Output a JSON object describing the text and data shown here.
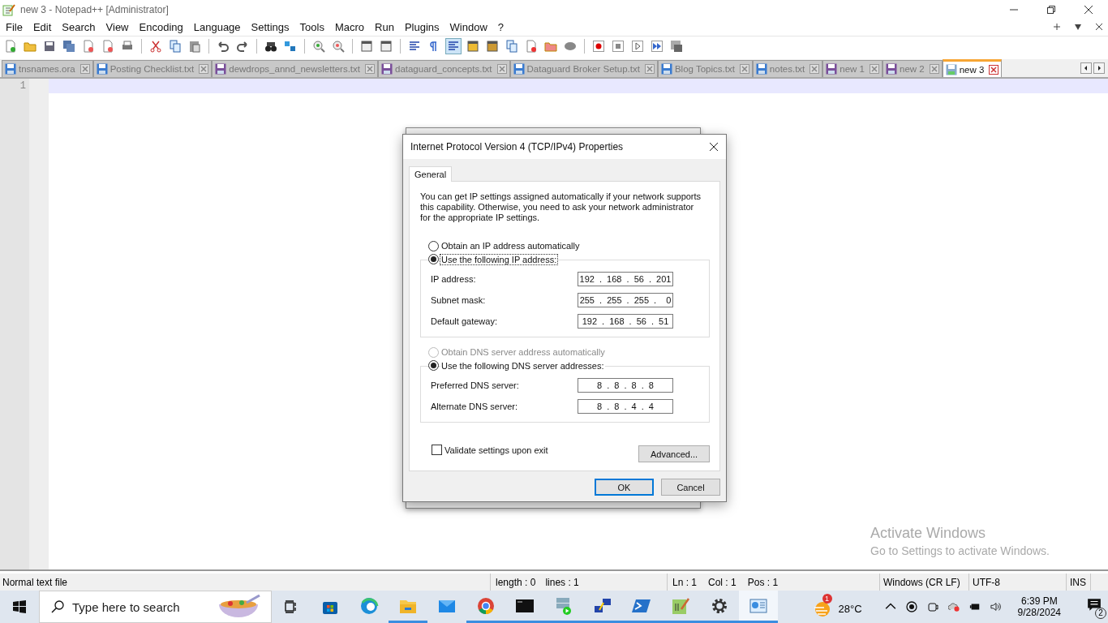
{
  "window": {
    "title": "new 3 - Notepad++ [Administrator]"
  },
  "menu": [
    "File",
    "Edit",
    "Search",
    "View",
    "Encoding",
    "Language",
    "Settings",
    "Tools",
    "Macro",
    "Run",
    "Plugins",
    "Window",
    "?"
  ],
  "tabs": [
    {
      "label": "tnsnames.ora",
      "selected": false,
      "unsaved": false
    },
    {
      "label": "Posting Checklist.txt",
      "selected": false,
      "unsaved": false
    },
    {
      "label": "dewdrops_annd_newsletters.txt",
      "selected": false,
      "unsaved": true
    },
    {
      "label": "dataguard_concepts.txt",
      "selected": false,
      "unsaved": true
    },
    {
      "label": "Dataguard Broker Setup.txt",
      "selected": false,
      "unsaved": false
    },
    {
      "label": "Blog Topics.txt",
      "selected": false,
      "unsaved": false
    },
    {
      "label": "notes.txt",
      "selected": false,
      "unsaved": false
    },
    {
      "label": "new 1",
      "selected": false,
      "unsaved": true
    },
    {
      "label": "new 2",
      "selected": false,
      "unsaved": true
    },
    {
      "label": "new 3",
      "selected": true,
      "unsaved": false
    }
  ],
  "editor": {
    "line_numbers": [
      "1"
    ]
  },
  "dialog": {
    "title": "Internet Protocol Version 4 (TCP/IPv4) Properties",
    "tabs": [
      {
        "label": "General",
        "selected": true
      }
    ],
    "description": "You can get IP settings assigned automatically if your network supports this capability. Otherwise, you need to ask your network administrator for the appropriate IP settings.",
    "ip_options": [
      {
        "label": "Obtain an IP address automatically",
        "selected": false,
        "disabled": false,
        "focused": false
      },
      {
        "label": "Use the following IP address:",
        "selected": true,
        "disabled": false,
        "focused": true
      }
    ],
    "ip_fields": [
      {
        "label": "IP address:",
        "value": "192 . 168 . 56 . 201"
      },
      {
        "label": "Subnet mask:",
        "value": "255 . 255 . 255 .  0"
      },
      {
        "label": "Default gateway:",
        "value": "192 . 168 . 56 . 51"
      }
    ],
    "dns_options": [
      {
        "label": "Obtain DNS server address automatically",
        "selected": false,
        "disabled": true,
        "focused": false
      },
      {
        "label": "Use the following DNS server addresses:",
        "selected": true,
        "disabled": false,
        "focused": false
      }
    ],
    "dns_fields": [
      {
        "label": "Preferred DNS server:",
        "value": "8 . 8 . 8 . 8"
      },
      {
        "label": "Alternate DNS server:",
        "value": "8 . 8 . 4 . 4"
      }
    ],
    "validate": {
      "label": "Validate settings upon exit",
      "checked": false
    },
    "advanced_button": "Advanced...",
    "buttons": [
      {
        "label": "OK",
        "default": true
      },
      {
        "label": "Cancel",
        "default": false
      }
    ]
  },
  "activation_notice": {
    "title": "Activate Windows",
    "message": "Go to Settings to activate Windows."
  },
  "status_bar": [
    [
      "Normal text file"
    ],
    [
      "length : 0",
      "lines : 1"
    ],
    [
      "Ln : 1",
      "Col : 1",
      "Pos : 1"
    ],
    [
      "Windows (CR LF)"
    ],
    [
      "UTF-8"
    ],
    [
      "INS"
    ]
  ],
  "taskbar": {
    "search_placeholder": "Type here to search",
    "apps": [
      {
        "kind": "store",
        "running": false,
        "active": false
      },
      {
        "kind": "edge",
        "running": false,
        "active": false
      },
      {
        "kind": "explorer",
        "running": true,
        "active": false
      },
      {
        "kind": "mail",
        "running": false,
        "active": false
      },
      {
        "kind": "chrome",
        "running": true,
        "active": false
      },
      {
        "kind": "terminal",
        "running": true,
        "active": false
      },
      {
        "kind": "vm",
        "running": true,
        "active": false
      },
      {
        "kind": "network",
        "running": true,
        "active": false
      },
      {
        "kind": "powershell",
        "running": true,
        "active": false
      },
      {
        "kind": "notepad",
        "running": true,
        "active": false
      },
      {
        "kind": "settings",
        "running": true,
        "active": false
      },
      {
        "kind": "control-panel",
        "running": true,
        "active": true
      }
    ],
    "weather": {
      "badge": "1",
      "temperature": "28°C"
    },
    "time": "6:39 PM",
    "date": "9/28/2024",
    "notifications": "2"
  }
}
